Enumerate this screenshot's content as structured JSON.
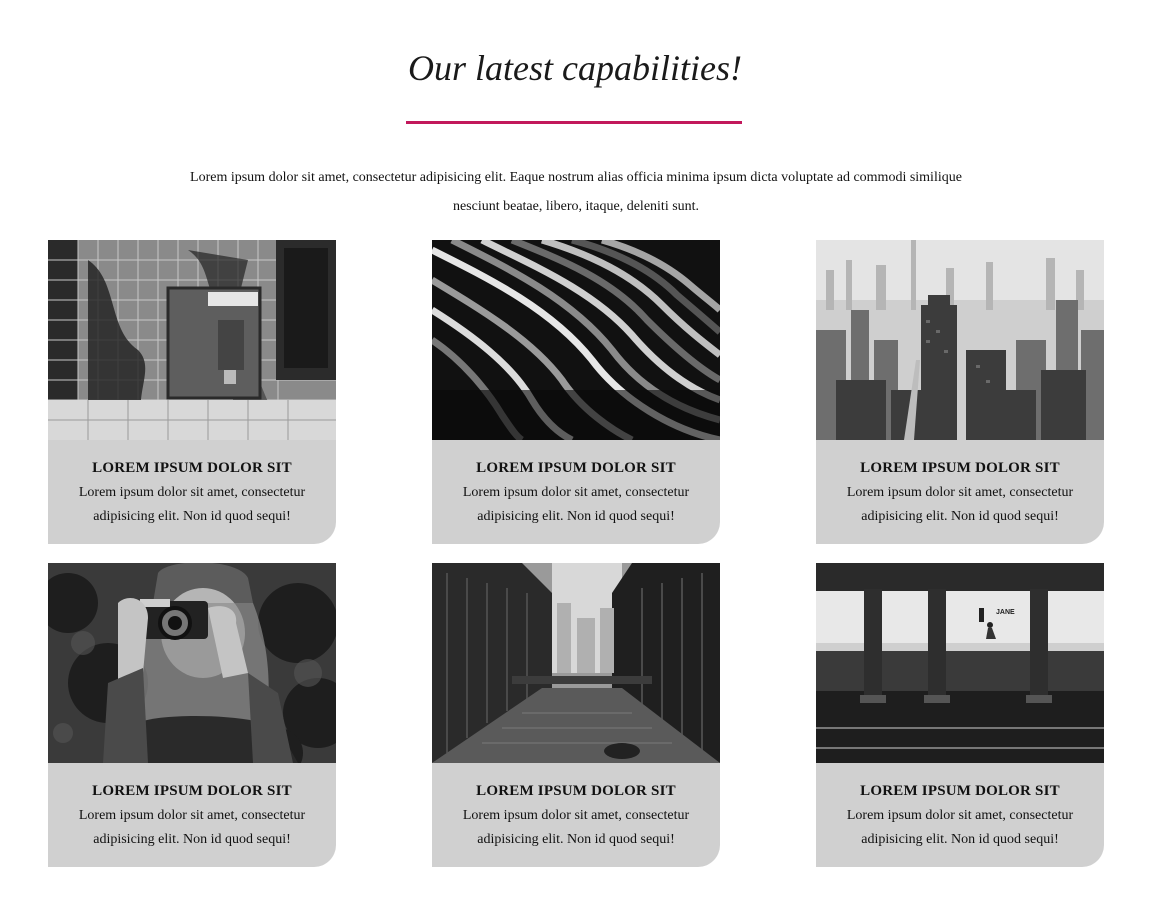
{
  "section": {
    "title": "Our latest capabilities!",
    "accent_color": "#c2185b",
    "intro": "Lorem ipsum dolor sit amet, consectetur adipisicing elit. Eaque nostrum alias officia minima ipsum dicta voluptate ad commodi similique nesciunt beatae, libero, itaque, deleniti sunt."
  },
  "cards": [
    {
      "image": "graffiti-wall-mailbox-photo",
      "title": "LOREM IPSUM DOLOR SIT",
      "text": "Lorem ipsum dolor sit amet, consectetur adipisicing elit. Non id quod sequi!"
    },
    {
      "image": "wavy-architecture-photo",
      "title": "LOREM IPSUM DOLOR SIT",
      "text": "Lorem ipsum dolor sit amet, consectetur adipisicing elit. Non id quod sequi!"
    },
    {
      "image": "foggy-city-skyline-photo",
      "title": "LOREM IPSUM DOLOR SIT",
      "text": "Lorem ipsum dolor sit amet, consectetur adipisicing elit. Non id quod sequi!"
    },
    {
      "image": "woman-with-camera-photo",
      "title": "LOREM IPSUM DOLOR SIT",
      "text": "Lorem ipsum dolor sit amet, consectetur adipisicing elit. Non id quod sequi!"
    },
    {
      "image": "city-canal-photo",
      "title": "LOREM IPSUM DOLOR SIT",
      "text": "Lorem ipsum dolor sit amet, consectetur adipisicing elit. Non id quod sequi!"
    },
    {
      "image": "subway-platform-photo",
      "title": "LOREM IPSUM DOLOR SIT",
      "text": "Lorem ipsum dolor sit amet, consectetur adipisicing elit. Non id quod sequi!",
      "sign_text": "JANE"
    }
  ]
}
